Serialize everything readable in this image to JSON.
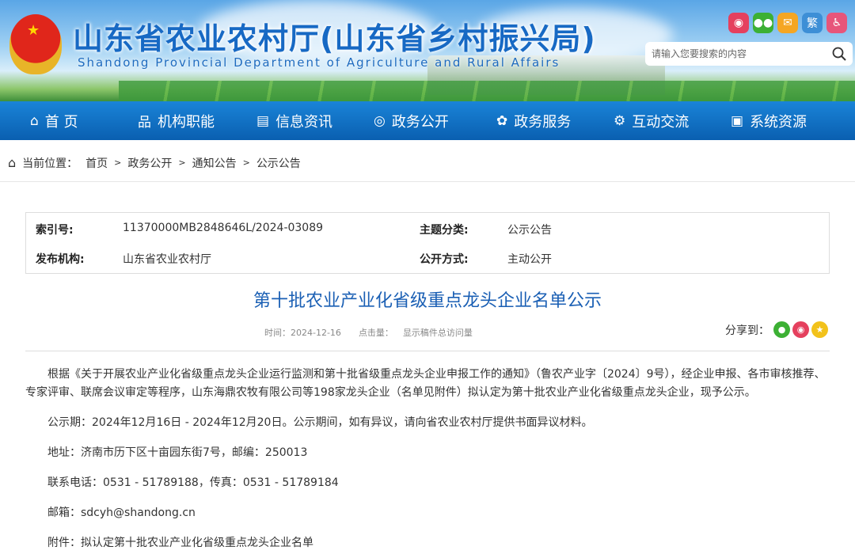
{
  "header": {
    "title": "山东省农业农村厅(山东省乡村振兴局)",
    "subtitle": "Shandong Provincial Department of Agriculture and Rural Affairs",
    "search_placeholder": "请输入您要搜索的内容",
    "social": [
      {
        "icon": "weibo-icon",
        "glyph": "◉",
        "color": "#e5405e"
      },
      {
        "icon": "wechat-icon",
        "glyph": "●●",
        "color": "#3cb034"
      },
      {
        "icon": "mail-icon",
        "glyph": "✉",
        "color": "#f5a623"
      },
      {
        "icon": "traditional-chinese-icon",
        "glyph": "繁",
        "color": "#3d8fd6"
      },
      {
        "icon": "accessibility-icon",
        "glyph": "♿",
        "color": "#e7557a"
      }
    ]
  },
  "nav": [
    {
      "label": "首 页",
      "icon": "⌂"
    },
    {
      "label": "机构职能",
      "icon": "品"
    },
    {
      "label": "信息资讯",
      "icon": "▤"
    },
    {
      "label": "政务公开",
      "icon": "◎"
    },
    {
      "label": "政务服务",
      "icon": "✿"
    },
    {
      "label": "互动交流",
      "icon": "⚙"
    },
    {
      "label": "系统资源",
      "icon": "▣"
    }
  ],
  "breadcrumb": {
    "label": "当前位置：",
    "items": [
      "首页",
      "政务公开",
      "通知公告",
      "公示公告"
    ],
    "sep": ">"
  },
  "info": {
    "index_label": "索引号:",
    "index_value": "11370000MB2848646L/2024-03089",
    "topic_label": "主题分类:",
    "topic_value": "公示公告",
    "org_label": "发布机构:",
    "org_value": "山东省农业农村厅",
    "mode_label": "公开方式:",
    "mode_value": "主动公开"
  },
  "article": {
    "title": "第十批农业产业化省级重点龙头企业名单公示",
    "time": "时间：2024-12-16",
    "clicks_label": "点击量：",
    "clicks_value": "显示稿件总访问量",
    "share_label": "分享到：",
    "paragraphs": [
      "根据《关于开展农业产业化省级重点龙头企业运行监测和第十批省级重点龙头企业申报工作的通知》（鲁农产业字〔2024〕9号），经企业申报、各市审核推荐、专家评审、联席会议审定等程序，山东海鼎农牧有限公司等198家龙头企业（名单见附件）拟认定为第十批农业产业化省级重点龙头企业，现予公示。",
      "公示期：2024年12月16日 - 2024年12月20日。公示期间，如有异议，请向省农业农村厅提供书面异议材料。",
      "地址：济南市历下区十亩园东街7号，邮编：250013",
      "联系电话：0531 - 51789188，传真：0531 - 51789184",
      "邮箱：sdcyh@shandong.cn",
      "附件：拟认定第十批农业产业化省级重点龙头企业名单"
    ]
  }
}
